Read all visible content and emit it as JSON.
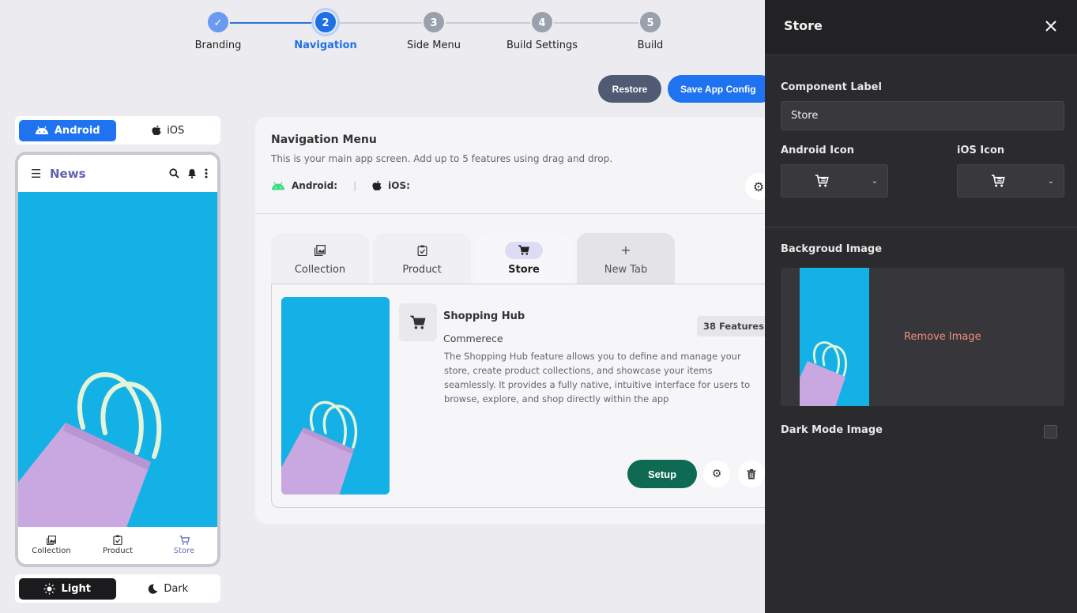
{
  "stepper": {
    "steps": [
      {
        "num": "✓",
        "label": "Branding",
        "state": "done"
      },
      {
        "num": "2",
        "label": "Navigation",
        "state": "active"
      },
      {
        "num": "3",
        "label": "Side Menu",
        "state": "todo"
      },
      {
        "num": "4",
        "label": "Build Settings",
        "state": "todo"
      },
      {
        "num": "5",
        "label": "Build",
        "state": "todo"
      }
    ]
  },
  "actions": {
    "restore": "Restore",
    "save": "Save App Config"
  },
  "preview": {
    "os_toggle": {
      "android": "Android",
      "ios": "iOS",
      "selected": "android"
    },
    "app_bar": {
      "title": "News"
    },
    "bottom_tabs": [
      {
        "label": "Collection",
        "icon": "gallery-icon"
      },
      {
        "label": "Product",
        "icon": "clipboard-check-icon"
      },
      {
        "label": "Store",
        "icon": "cart-icon",
        "active": true
      }
    ],
    "theme_toggle": {
      "light": "Light",
      "dark": "Dark",
      "selected": "light"
    }
  },
  "nav_menu": {
    "title": "Navigation Menu",
    "description": "This is your main app screen. Add up to 5 features using drag and drop.",
    "android_label": "Android:",
    "ios_label": "iOS:",
    "tabs": [
      {
        "label": "Collection",
        "icon": "gallery-icon"
      },
      {
        "label": "Product",
        "icon": "clipboard-check-icon"
      },
      {
        "label": "Store",
        "icon": "cart-icon",
        "active": true
      },
      {
        "label": "New Tab",
        "icon": "plus-icon"
      }
    ],
    "feature": {
      "name": "Shopping Hub",
      "category": "Commerece",
      "count": "38 Features",
      "description": "The Shopping Hub feature allows you to define and manage your store, create product collections, and showcase your items seamlessly. It provides a fully native, intuitive interface for users to browse, explore, and shop directly within the app",
      "setup_label": "Setup"
    }
  },
  "panel": {
    "title": "Store",
    "component_label": "Component Label",
    "component_value": "Store",
    "android_icon_label": "Android Icon",
    "ios_icon_label": "iOS Icon",
    "bg_image_label": "Backgroud Image",
    "remove_image": "Remove Image",
    "dark_mode_label": "Dark Mode Image",
    "dark_mode_checked": false
  },
  "colors": {
    "primary": "#1f73f0",
    "setup_green": "#0e6a52",
    "image_blue": "#14b1e6",
    "bag_lilac": "#c9a7e0",
    "panel_bg": "#2b2b2e",
    "remove_text": "#f08e7a"
  }
}
